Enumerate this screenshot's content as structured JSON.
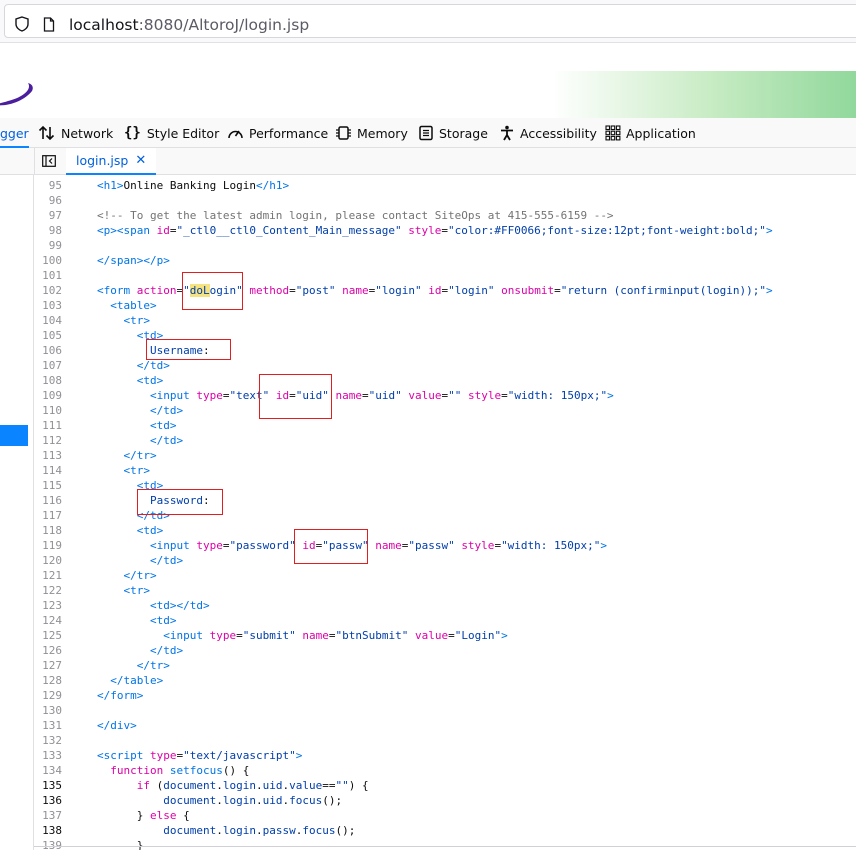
{
  "urlbar": {
    "host": "localhost",
    "path": ":8080/AltoroJ/login.jsp"
  },
  "devtools": {
    "tabs": [
      {
        "label": "gger",
        "icon": "debugger-icon"
      },
      {
        "label": "Network",
        "icon": "network-icon"
      },
      {
        "label": "Style Editor",
        "icon": "style-editor-icon"
      },
      {
        "label": "Performance",
        "icon": "performance-icon"
      },
      {
        "label": "Memory",
        "icon": "memory-icon"
      },
      {
        "label": "Storage",
        "icon": "storage-icon"
      },
      {
        "label": "Accessibility",
        "icon": "accessibility-icon"
      },
      {
        "label": "Application",
        "icon": "application-icon"
      }
    ],
    "active_tab": "gger",
    "source_tab": {
      "label": "login.jsp",
      "close": "✕"
    }
  },
  "colors": {
    "accent": "#0a84ff",
    "annotation": "#e02020",
    "highlight": "#f5e280"
  },
  "editor": {
    "current_line": "102",
    "lines": [
      {
        "n": "95",
        "t": "<h1>Online Banking Login</h1>"
      },
      {
        "n": "96",
        "t": ""
      },
      {
        "n": "97",
        "t": "<!-- To get the latest admin login, please contact SiteOps at 415-555-6159 -->"
      },
      {
        "n": "98",
        "t": "<p><span id=\"_ctl0__ctl0_Content_Main_message\" style=\"color:#FF0066;font-size:12pt;font-weight:bold;\">"
      },
      {
        "n": "99",
        "t": ""
      },
      {
        "n": "100",
        "t": "</span></p>"
      },
      {
        "n": "101",
        "t": ""
      },
      {
        "n": "102",
        "t": "<form action=\"doLogin\" method=\"post\" name=\"login\" id=\"login\" onsubmit=\"return (confirminput(login));\">"
      },
      {
        "n": "103",
        "t": "  <table>"
      },
      {
        "n": "104",
        "t": "    <tr>"
      },
      {
        "n": "105",
        "t": "      <td>"
      },
      {
        "n": "106",
        "t": "        Username:"
      },
      {
        "n": "107",
        "t": "      </td>"
      },
      {
        "n": "108",
        "t": "      <td>"
      },
      {
        "n": "109",
        "t": "        <input type=\"text\" id=\"uid\" name=\"uid\" value=\"\" style=\"width: 150px;\">"
      },
      {
        "n": "110",
        "t": "        </td>"
      },
      {
        "n": "111",
        "t": "        <td>"
      },
      {
        "n": "112",
        "t": "        </td>"
      },
      {
        "n": "113",
        "t": "    </tr>"
      },
      {
        "n": "114",
        "t": "    <tr>"
      },
      {
        "n": "115",
        "t": "      <td>"
      },
      {
        "n": "116",
        "t": "        Password:"
      },
      {
        "n": "117",
        "t": "      </td>"
      },
      {
        "n": "118",
        "t": "      <td>"
      },
      {
        "n": "119",
        "t": "        <input type=\"password\" id=\"passw\" name=\"passw\" style=\"width: 150px;\">"
      },
      {
        "n": "120",
        "t": "        </td>"
      },
      {
        "n": "121",
        "t": "    </tr>"
      },
      {
        "n": "122",
        "t": "    <tr>"
      },
      {
        "n": "123",
        "t": "        <td></td>"
      },
      {
        "n": "124",
        "t": "        <td>"
      },
      {
        "n": "125",
        "t": "          <input type=\"submit\" name=\"btnSubmit\" value=\"Login\">"
      },
      {
        "n": "126",
        "t": "        </td>"
      },
      {
        "n": "127",
        "t": "      </tr>"
      },
      {
        "n": "128",
        "t": "  </table>"
      },
      {
        "n": "129",
        "t": "</form>"
      },
      {
        "n": "130",
        "t": ""
      },
      {
        "n": "131",
        "t": "</div>"
      },
      {
        "n": "132",
        "t": ""
      },
      {
        "n": "133",
        "t": "<script type=\"text/javascript\">"
      },
      {
        "n": "134",
        "t": "  function setfocus() {"
      },
      {
        "n": "135",
        "t": "      if (document.login.uid.value==\"\") {"
      },
      {
        "n": "136",
        "t": "          document.login.uid.focus();"
      },
      {
        "n": "137",
        "t": "      } else {"
      },
      {
        "n": "138",
        "t": "          document.login.passw.focus();"
      },
      {
        "n": "139",
        "t": "      }"
      }
    ]
  }
}
